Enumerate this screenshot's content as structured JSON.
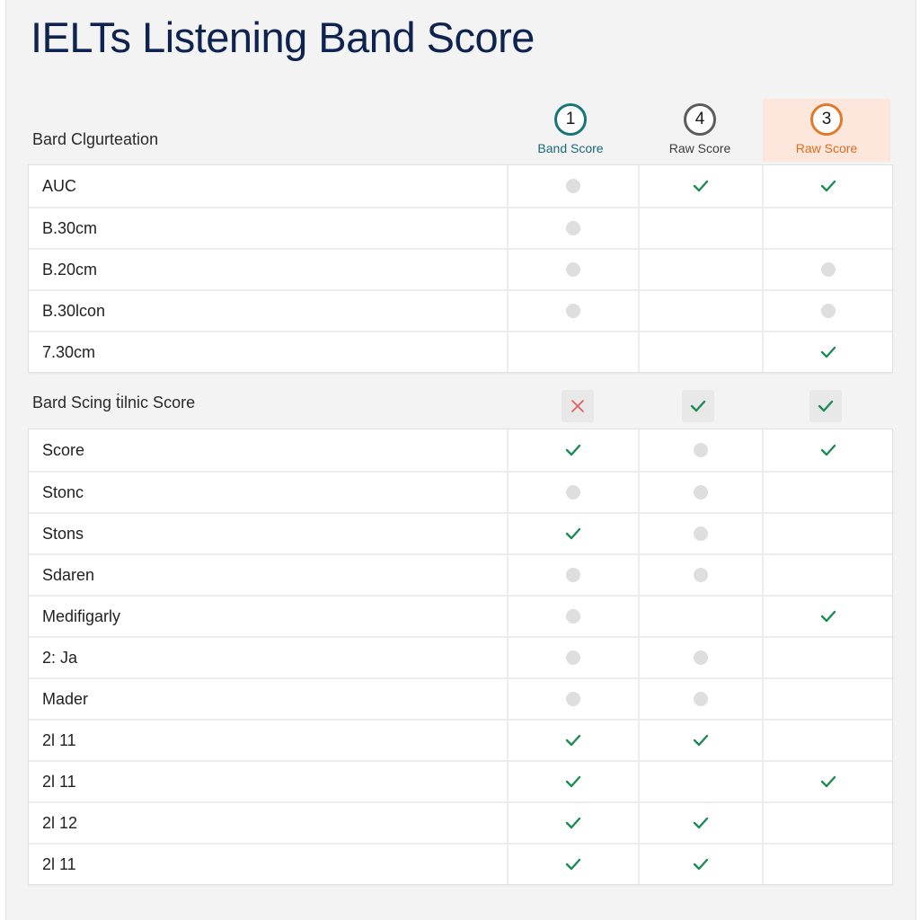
{
  "title": "IELTs Listening Band Score",
  "columns": [
    {
      "number": "1",
      "label": "Band Score",
      "color": "#15757a"
    },
    {
      "number": "4",
      "label": "Raw Score",
      "color": "#5c5c5c"
    },
    {
      "number": "3",
      "label": "Raw Score",
      "color": "#e07a2a",
      "highlighted": true
    }
  ],
  "section1": {
    "label": "Bard Clgurteation",
    "rows": [
      {
        "name": "AUC",
        "cells": [
          "dot",
          "check",
          "check"
        ]
      },
      {
        "name": "B.30cm",
        "cells": [
          "dot",
          "",
          ""
        ]
      },
      {
        "name": "B.20cm",
        "cells": [
          "dot",
          "",
          "dot"
        ]
      },
      {
        "name": "B.30lcon",
        "cells": [
          "dot",
          "",
          "dot"
        ]
      },
      {
        "name": "7.30cm",
        "cells": [
          "",
          "",
          "check"
        ]
      }
    ]
  },
  "section2": {
    "label": "Bard Scing ṫilnic Score",
    "header_marks": [
      "cross",
      "check",
      "check"
    ],
    "rows": [
      {
        "name": "Score",
        "cells": [
          "check",
          "dot",
          "check"
        ]
      },
      {
        "name": "Stonc",
        "cells": [
          "dot",
          "dot",
          ""
        ]
      },
      {
        "name": "Stons",
        "cells": [
          "check",
          "dot",
          ""
        ]
      },
      {
        "name": "Sdaren",
        "cells": [
          "dot",
          "dot",
          ""
        ]
      },
      {
        "name": "Medifigarly",
        "cells": [
          "dot",
          "",
          "check"
        ]
      },
      {
        "name": "2: Ja",
        "cells": [
          "dot",
          "dot",
          ""
        ]
      },
      {
        "name": "Mader",
        "cells": [
          "dot",
          "dot",
          ""
        ]
      },
      {
        "name": "2l 11",
        "cells": [
          "check",
          "check",
          ""
        ]
      },
      {
        "name": "2l 11",
        "cells": [
          "check",
          "",
          "check"
        ]
      },
      {
        "name": "2l 12",
        "cells": [
          "check",
          "check",
          ""
        ]
      },
      {
        "name": "2l 11",
        "cells": [
          "check",
          "check",
          ""
        ]
      }
    ]
  },
  "colors": {
    "check": "#1e8a55",
    "cross": "#e05a5a",
    "dot": "#dedede",
    "title": "#0f2350"
  }
}
